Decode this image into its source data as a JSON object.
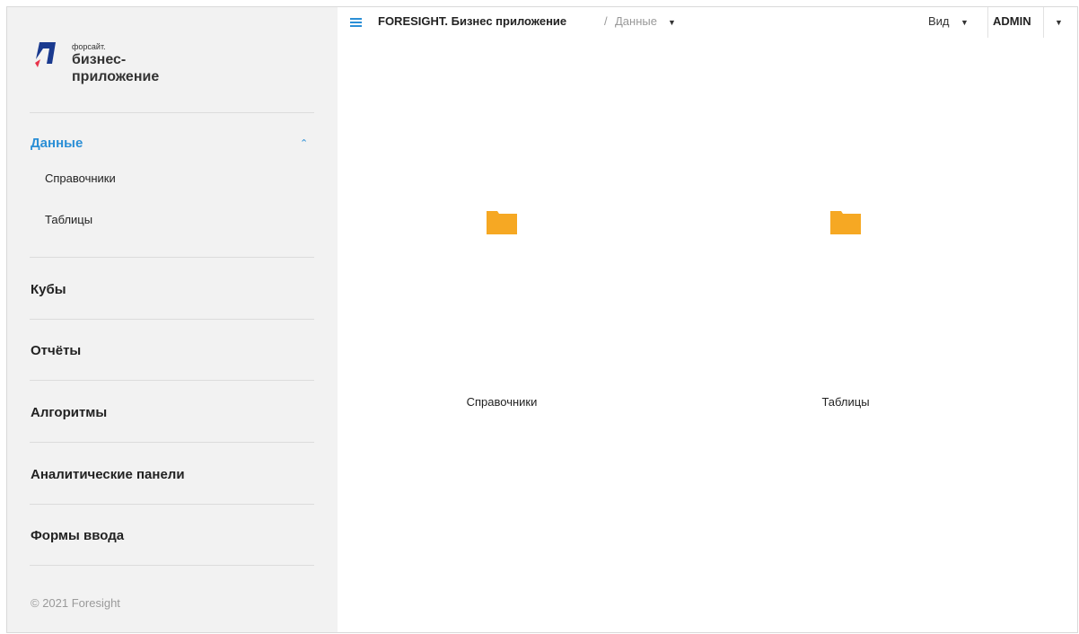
{
  "brand": {
    "small": "форсайт.",
    "line1": "бизнес-",
    "line2": "приложение"
  },
  "sidebar": {
    "sections": [
      {
        "label": "Данные",
        "expanded": true,
        "children": [
          "Справочники",
          "Таблицы"
        ]
      },
      {
        "label": "Кубы"
      },
      {
        "label": "Отчёты"
      },
      {
        "label": "Алгоритмы"
      },
      {
        "label": "Аналитические панели"
      },
      {
        "label": "Формы ввода"
      }
    ],
    "copyright": "© 2021 Foresight"
  },
  "header": {
    "app_title": "FORESIGHT. Бизнес приложение",
    "separator": "/",
    "breadcrumb": "Данные",
    "view_label": "Вид",
    "user": "ADMIN"
  },
  "content": {
    "items": [
      {
        "label": "Справочники",
        "icon": "folder-icon"
      },
      {
        "label": "Таблицы",
        "icon": "folder-icon"
      }
    ]
  },
  "colors": {
    "accent": "#2b8fd6",
    "folder": "#f6a823",
    "sidebar_bg": "#f2f2f2"
  }
}
